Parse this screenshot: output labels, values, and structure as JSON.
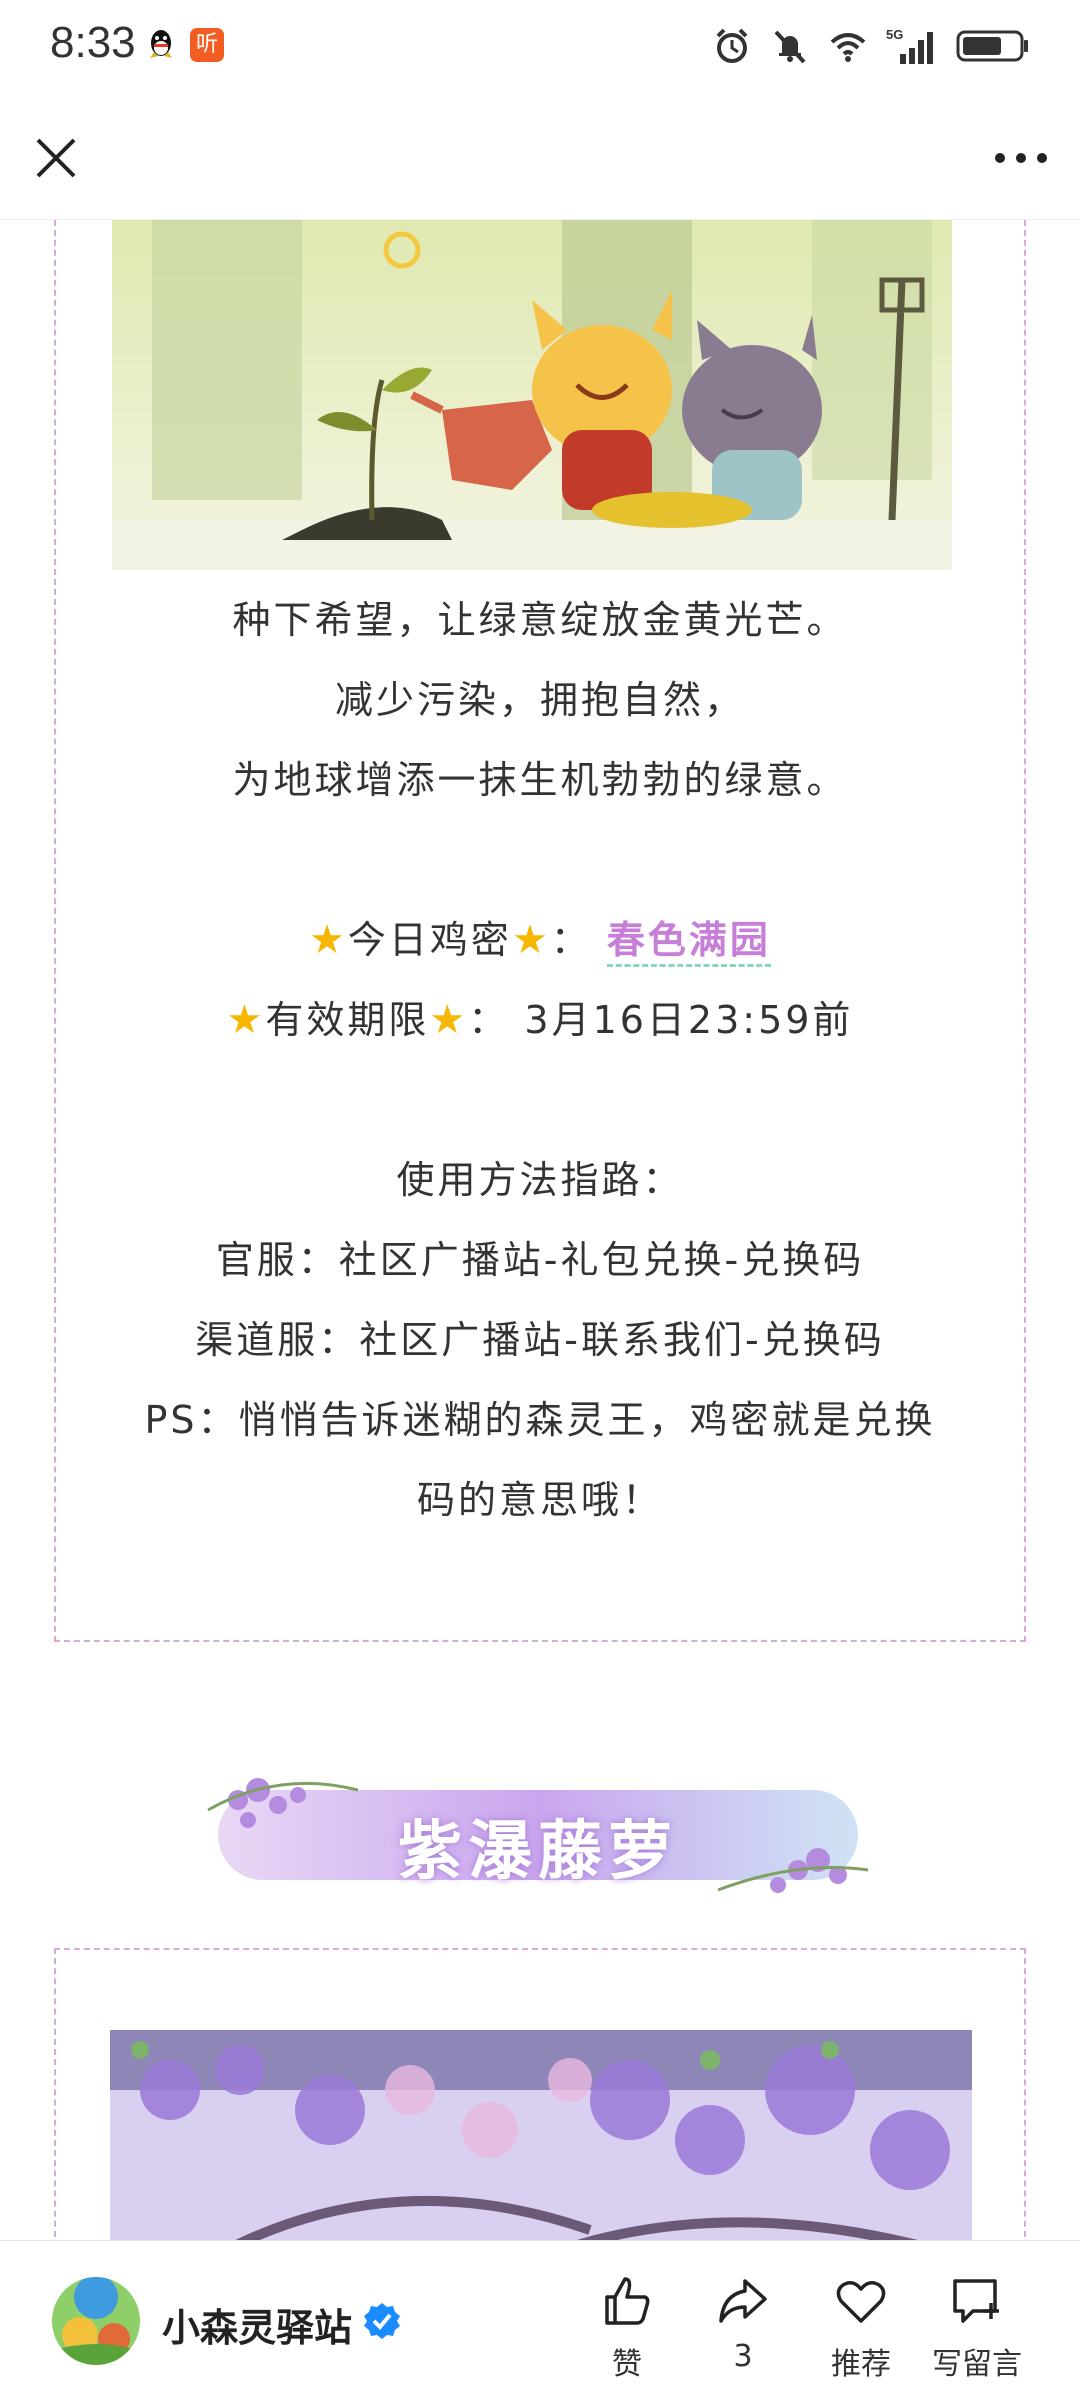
{
  "status_bar": {
    "time": "8:33",
    "listen_icon_text": "听",
    "icons": [
      "qq-icon",
      "listen-icon",
      "alarm-icon",
      "mute-icon",
      "wifi-icon",
      "5g-signal-icon",
      "battery-icon"
    ],
    "network": "5G"
  },
  "nav": {
    "close_icon": "close-icon",
    "more_icon": "more-icon"
  },
  "article": {
    "lines": [
      "种下希望，让绿意绽放金黄光芒。",
      "减少污染，拥抱自然，",
      "为地球增添一抹生机勃勃的绿意。"
    ],
    "code_label": "今日鸡密",
    "code_separator": "：",
    "code_value": "春色满园",
    "expiry_label": "有效期限",
    "expiry_separator": "：",
    "expiry_value": "3月16日23:59前",
    "usage_title": "使用方法指路：",
    "usage_official": "官服：社区广播站-礼包兑换-兑换码",
    "usage_channel": "渠道服：社区广播站-联系我们-兑换码",
    "ps_line1": "PS：悄悄告诉迷糊的森灵王，鸡密就是兑换",
    "ps_line2": "码的意思哦！",
    "section_banner_title": "紫瀑藤萝",
    "colors": {
      "highlight": "#c77ed8",
      "border": "#d9a9d9",
      "underline": "#88d5c5",
      "star": "#f5b700"
    }
  },
  "bottom_bar": {
    "account_name": "小森灵驿站",
    "like_label": "赞",
    "share_count": "3",
    "recommend_label": "推荐",
    "comment_label": "写留言"
  }
}
